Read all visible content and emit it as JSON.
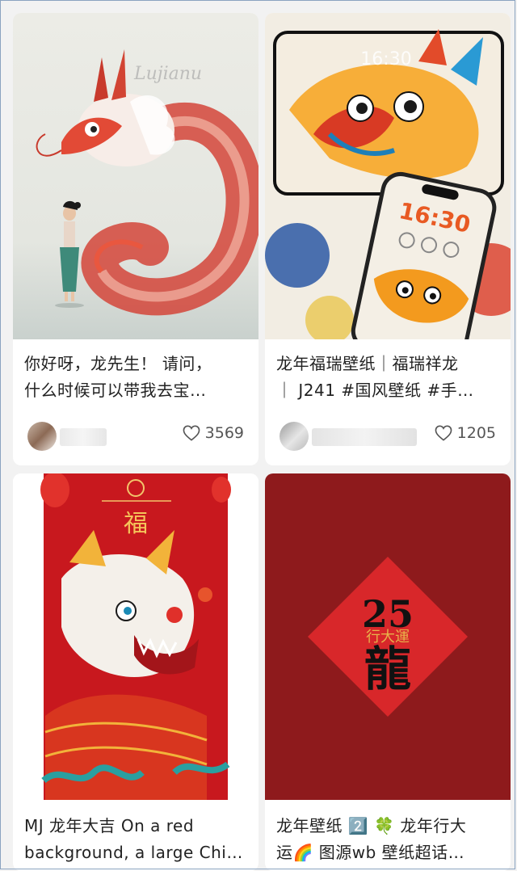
{
  "feed": {
    "cards": [
      {
        "title_line1": "你好呀，龙先生！ 请问，",
        "title_line2": "什么时候可以带我去宝…",
        "likes": "3569",
        "image_subject": "red dragon and little girl illustration",
        "image_signature": "Lujianu"
      },
      {
        "title_line1": "龙年福瑞壁纸｜福瑞祥龙",
        "title_line2": "｜ J241 #国风壁纸  #手…",
        "likes": "1205",
        "image_subject": "colorful dragon wallpaper on phone mockups",
        "lock_time_large": "16:30",
        "lock_time_phone": "16:30"
      },
      {
        "title_line1": "MJ 龙年大吉 On a red",
        "title_line2": "background, a large Chi…",
        "image_subject": "red Chinese dragon with fu character",
        "image_char": "福"
      },
      {
        "title_line1": "龙年壁纸 2️⃣ 🍀 龙年行大",
        "title_line2": "运🌈 图源wb 壁纸超话…",
        "image_subject": "dark red background with diamond couplet",
        "image_text_number": "25",
        "image_text_phrase": "行大運",
        "image_text_char": "龍"
      }
    ]
  },
  "colors": {
    "card_bg": "#ffffff",
    "page_bg": "#f2f2f2",
    "red_dark": "#8e1a1c",
    "red_bright": "#d8272a"
  }
}
